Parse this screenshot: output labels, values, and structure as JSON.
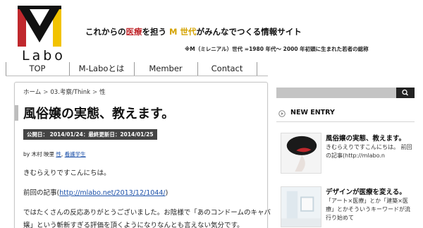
{
  "brand": {
    "logo_text": "Labo",
    "tagline_parts": [
      "これからの",
      "医療",
      "を担う ",
      "M 世代",
      "がみんなでつくる情報サイト"
    ],
    "subnote": "※M（ミレニアル）世代 =1980 年代〜 2000 年初頭に生まれた若者の総称",
    "colors": {
      "red": "#c0282d",
      "yellow": "#f2c300",
      "black": "#111111"
    }
  },
  "nav": {
    "items": [
      {
        "label": "TOP"
      },
      {
        "label": "M-Laboとは"
      },
      {
        "label": "Member"
      },
      {
        "label": "Contact"
      }
    ]
  },
  "breadcrumb": {
    "items": [
      "ホーム",
      "03.考察/Think",
      "性"
    ],
    "separator": ">"
  },
  "article": {
    "title": "風俗嬢の実態、教えます。",
    "dates": "公開日： 2014/01/24：最終更新日：2014/01/25",
    "meta_prefix": "by 木村 映里",
    "tag_sep": " ",
    "tags": [
      "性",
      "看護学生"
    ],
    "tag_comma": ", ",
    "greeting": "きむらえりですこんにちは。",
    "prev_prefix": "前回の記事(",
    "prev_link": "http://mlabo.net/2013/12/1044/",
    "prev_suffix": ")",
    "line3": "ではたくさんの反応ありがとうございました。お陰様で「あのコンドームのキャバ",
    "line4": "嬢」という斬新すぎる評価を頂くようになりなんとも言えない気分です。"
  },
  "sidebar": {
    "search_icon": "search-icon",
    "section_title": "NEW ENTRY",
    "entries": [
      {
        "title": "風俗嬢の実態、教えます。",
        "excerpt": "きむらえりですこんにちは。 前回の記事(http://mlabo.n"
      },
      {
        "title": "デザインが医療を変える。",
        "excerpt": "「アート×医療」とか「建築×医療」とかそういうキーワードが流行り始めて"
      }
    ]
  }
}
